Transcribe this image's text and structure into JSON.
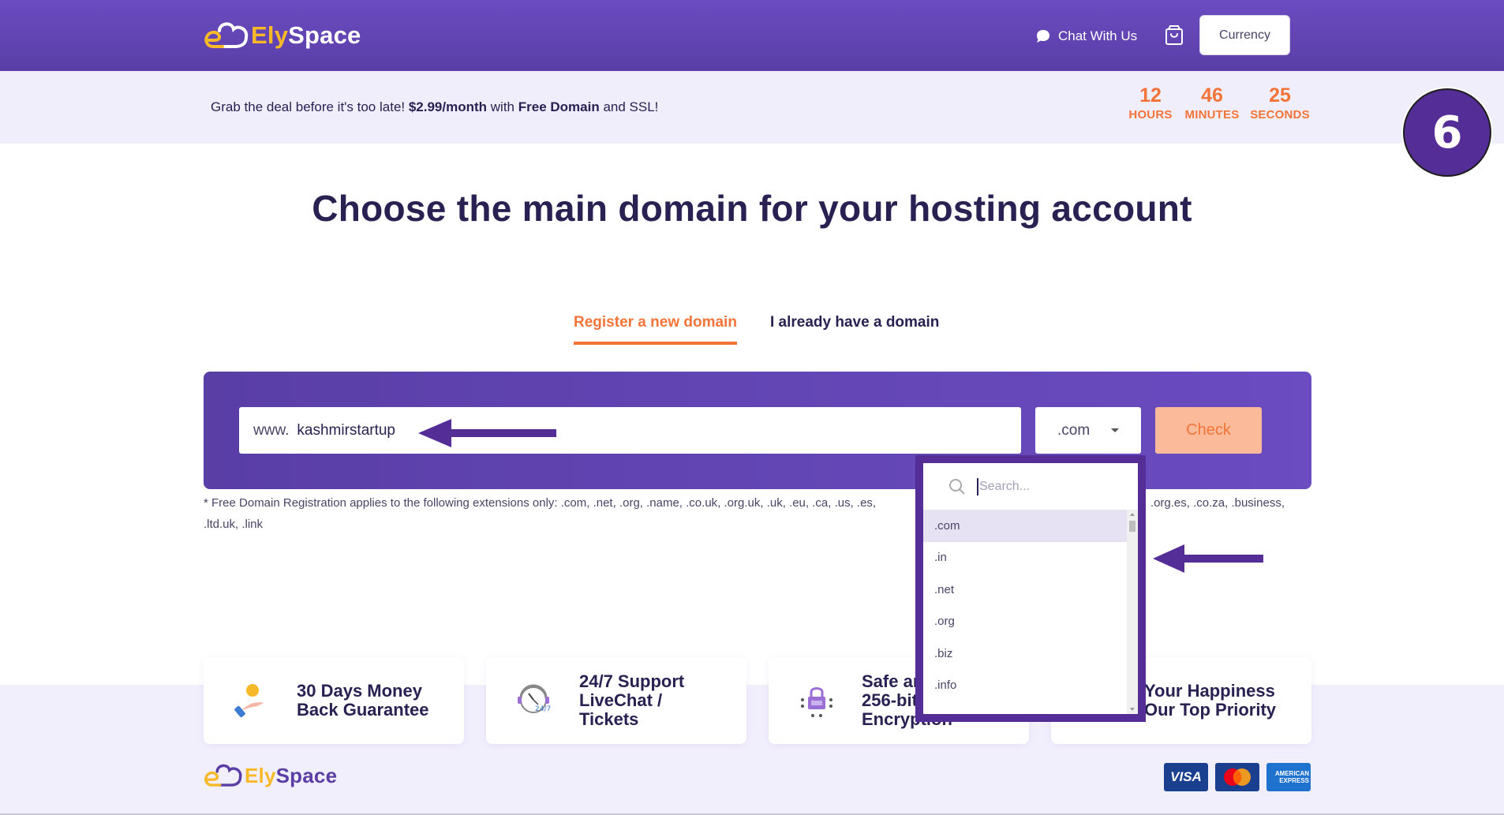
{
  "header": {
    "logo": {
      "part1": "Ely",
      "part2": "Space"
    },
    "chat_label": "Chat With Us",
    "currency_label": "Currency",
    "icons": {
      "chat": "chat-bubble-icon",
      "cart": "shopping-bag-icon"
    }
  },
  "promo": {
    "text_pre": "Grab the deal before it's too late! ",
    "price": "$2.99/month",
    "text_mid": " with ",
    "highlight": "Free Domain",
    "text_post": " and SSL!",
    "countdown": {
      "hours": "12",
      "hours_label": "HOURS",
      "minutes": "46",
      "minutes_label": "MINUTES",
      "seconds": "25",
      "seconds_label": "SECONDS"
    }
  },
  "step_badge": "6",
  "page_title": "Choose the main domain for your hosting account",
  "tabs": [
    {
      "label": "Register a new domain",
      "active": true
    },
    {
      "label": "I already have a domain",
      "active": false
    }
  ],
  "search": {
    "prefix": "www.",
    "value": "kashmirstartup",
    "selected_tld": ".com",
    "check_label": "Check"
  },
  "footnote": {
    "line1_left": "* Free Domain Registration applies to the following extensions only: .com, .net, .org, .name, .co.uk, .org.uk, .uk, .eu, .ca, .us, .es,",
    "line1_right": ".org.es, .co.za, .business,",
    "line2": ".ltd.uk, .link"
  },
  "dropdown": {
    "search_placeholder": "Search...",
    "options": [
      ".com",
      ".in",
      ".net",
      ".org",
      ".biz",
      ".info"
    ],
    "highlighted_index": 0
  },
  "features": [
    {
      "icon": "money-back-hand-coin-icon",
      "lines": [
        "30 Days Money",
        "Back Guarantee"
      ]
    },
    {
      "icon": "support-clock-247-icon",
      "lines": [
        "24/7 Support",
        "LiveChat /",
        "Tickets"
      ]
    },
    {
      "icon": "encryption-lock-icon",
      "lines": [
        "Safe and",
        "256-bit",
        "Encryption"
      ]
    },
    {
      "icon": "happiness-icon",
      "lines": [
        "Your Happiness",
        "Our Top Priority"
      ]
    }
  ],
  "footer": {
    "logo": {
      "part1": "Ely",
      "part2": "Space"
    },
    "payments": [
      "VISA",
      "Mastercard",
      "American Express"
    ],
    "amex_lines": [
      "AMERICAN",
      "EXPRESS"
    ]
  },
  "colors": {
    "brand_purple": "#5a3ea6",
    "accent_orange": "#f37438",
    "logo_yellow": "#f7b928",
    "annotation_purple": "#552d96"
  }
}
